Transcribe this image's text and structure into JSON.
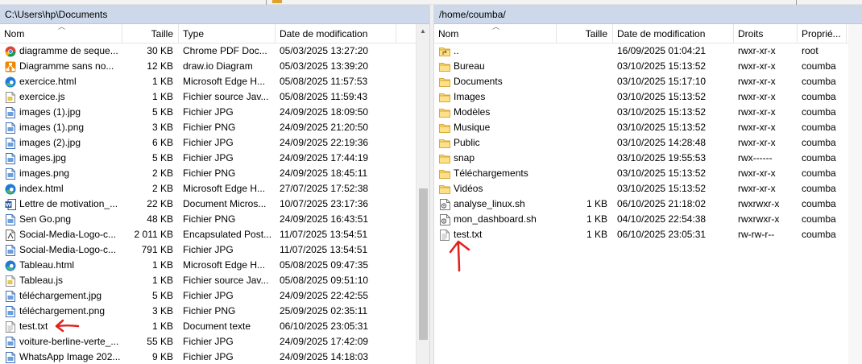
{
  "local": {
    "path": "C:\\Users\\hp\\Documents",
    "columns": {
      "name": "Nom",
      "size": "Taille",
      "type": "Type",
      "modified": "Date de modification"
    },
    "files": [
      {
        "icon": "chrome-pdf-icon",
        "name": "diagramme de seque...",
        "size": "30 KB",
        "type": "Chrome PDF Doc...",
        "modified": "05/03/2025 13:27:20"
      },
      {
        "icon": "drawio-icon",
        "name": "Diagramme sans no...",
        "size": "12 KB",
        "type": "draw.io Diagram",
        "modified": "05/03/2025 13:39:20"
      },
      {
        "icon": "edge-icon",
        "name": "exercice.html",
        "size": "1 KB",
        "type": "Microsoft Edge H...",
        "modified": "05/08/2025 11:57:53"
      },
      {
        "icon": "js-file-icon",
        "name": "exercice.js",
        "size": "1 KB",
        "type": "Fichier source Jav...",
        "modified": "05/08/2025 11:59:43"
      },
      {
        "icon": "image-file-icon",
        "name": "images (1).jpg",
        "size": "5 KB",
        "type": "Fichier JPG",
        "modified": "24/09/2025 18:09:50"
      },
      {
        "icon": "image-file-icon",
        "name": "images (1).png",
        "size": "3 KB",
        "type": "Fichier PNG",
        "modified": "24/09/2025 21:20:50"
      },
      {
        "icon": "image-file-icon",
        "name": "images (2).jpg",
        "size": "6 KB",
        "type": "Fichier JPG",
        "modified": "24/09/2025 22:19:36"
      },
      {
        "icon": "image-file-icon",
        "name": "images.jpg",
        "size": "5 KB",
        "type": "Fichier JPG",
        "modified": "24/09/2025 17:44:19"
      },
      {
        "icon": "image-file-icon",
        "name": "images.png",
        "size": "2 KB",
        "type": "Fichier PNG",
        "modified": "24/09/2025 18:45:11"
      },
      {
        "icon": "edge-icon",
        "name": "index.html",
        "size": "2 KB",
        "type": "Microsoft Edge H...",
        "modified": "27/07/2025 17:52:38"
      },
      {
        "icon": "word-icon",
        "name": "Lettre de motivation_...",
        "size": "22 KB",
        "type": "Document Micros...",
        "modified": "10/07/2025 23:17:36"
      },
      {
        "icon": "image-file-icon",
        "name": "Sen Go.png",
        "size": "48 KB",
        "type": "Fichier PNG",
        "modified": "24/09/2025 16:43:51"
      },
      {
        "icon": "eps-file-icon",
        "name": "Social-Media-Logo-c...",
        "size": "2 011 KB",
        "type": "Encapsulated Post...",
        "modified": "11/07/2025 13:54:51"
      },
      {
        "icon": "image-file-icon",
        "name": "Social-Media-Logo-c...",
        "size": "791 KB",
        "type": "Fichier JPG",
        "modified": "11/07/2025 13:54:51"
      },
      {
        "icon": "edge-icon",
        "name": "Tableau.html",
        "size": "1 KB",
        "type": "Microsoft Edge H...",
        "modified": "05/08/2025 09:47:35"
      },
      {
        "icon": "js-file-icon",
        "name": "Tableau.js",
        "size": "1 KB",
        "type": "Fichier source Jav...",
        "modified": "05/08/2025 09:51:10"
      },
      {
        "icon": "image-file-icon",
        "name": "téléchargement.jpg",
        "size": "5 KB",
        "type": "Fichier JPG",
        "modified": "24/09/2025 22:42:55"
      },
      {
        "icon": "image-file-icon",
        "name": "téléchargement.png",
        "size": "3 KB",
        "type": "Fichier PNG",
        "modified": "25/09/2025 02:35:11"
      },
      {
        "icon": "text-file-icon",
        "name": "test.txt",
        "size": "1 KB",
        "type": "Document texte",
        "modified": "06/10/2025 23:05:31"
      },
      {
        "icon": "image-file-icon",
        "name": "voiture-berline-verte_...",
        "size": "55 KB",
        "type": "Fichier JPG",
        "modified": "24/09/2025 17:42:09"
      },
      {
        "icon": "image-file-icon",
        "name": "WhatsApp Image 202...",
        "size": "9 KB",
        "type": "Fichier JPG",
        "modified": "24/09/2025 14:18:03"
      }
    ]
  },
  "remote": {
    "path": "/home/coumba/",
    "columns": {
      "name": "Nom",
      "size": "Taille",
      "modified": "Date de modification",
      "perms": "Droits",
      "owner": "Proprié..."
    },
    "files": [
      {
        "icon": "parent-folder-icon",
        "name": "..",
        "size": "",
        "modified": "16/09/2025 01:04:21",
        "perms": "rwxr-xr-x",
        "owner": "root"
      },
      {
        "icon": "folder-icon",
        "name": "Bureau",
        "size": "",
        "modified": "03/10/2025 15:13:52",
        "perms": "rwxr-xr-x",
        "owner": "coumba"
      },
      {
        "icon": "folder-icon",
        "name": "Documents",
        "size": "",
        "modified": "03/10/2025 15:17:10",
        "perms": "rwxr-xr-x",
        "owner": "coumba"
      },
      {
        "icon": "folder-icon",
        "name": "Images",
        "size": "",
        "modified": "03/10/2025 15:13:52",
        "perms": "rwxr-xr-x",
        "owner": "coumba"
      },
      {
        "icon": "folder-icon",
        "name": "Modèles",
        "size": "",
        "modified": "03/10/2025 15:13:52",
        "perms": "rwxr-xr-x",
        "owner": "coumba"
      },
      {
        "icon": "folder-icon",
        "name": "Musique",
        "size": "",
        "modified": "03/10/2025 15:13:52",
        "perms": "rwxr-xr-x",
        "owner": "coumba"
      },
      {
        "icon": "folder-icon",
        "name": "Public",
        "size": "",
        "modified": "03/10/2025 14:28:48",
        "perms": "rwxr-xr-x",
        "owner": "coumba"
      },
      {
        "icon": "folder-icon",
        "name": "snap",
        "size": "",
        "modified": "03/10/2025 19:55:53",
        "perms": "rwx------",
        "owner": "coumba"
      },
      {
        "icon": "folder-icon",
        "name": "Téléchargements",
        "size": "",
        "modified": "03/10/2025 15:13:52",
        "perms": "rwxr-xr-x",
        "owner": "coumba"
      },
      {
        "icon": "folder-icon",
        "name": "Vidéos",
        "size": "",
        "modified": "03/10/2025 15:13:52",
        "perms": "rwxr-xr-x",
        "owner": "coumba"
      },
      {
        "icon": "script-file-icon",
        "name": "analyse_linux.sh",
        "size": "1 KB",
        "modified": "06/10/2025 21:18:02",
        "perms": "rwxrwxr-x",
        "owner": "coumba"
      },
      {
        "icon": "script-file-icon",
        "name": "mon_dashboard.sh",
        "size": "1 KB",
        "modified": "04/10/2025 22:54:38",
        "perms": "rwxrwxr-x",
        "owner": "coumba"
      },
      {
        "icon": "text-file-icon",
        "name": "test.txt",
        "size": "1 KB",
        "modified": "06/10/2025 23:05:31",
        "perms": "rw-rw-r--",
        "owner": "coumba"
      }
    ]
  },
  "annotations": [
    {
      "name": "red-arrow-annotation-local",
      "color": "#e0201b"
    },
    {
      "name": "red-arrow-annotation-remote",
      "color": "#e0201b"
    }
  ]
}
